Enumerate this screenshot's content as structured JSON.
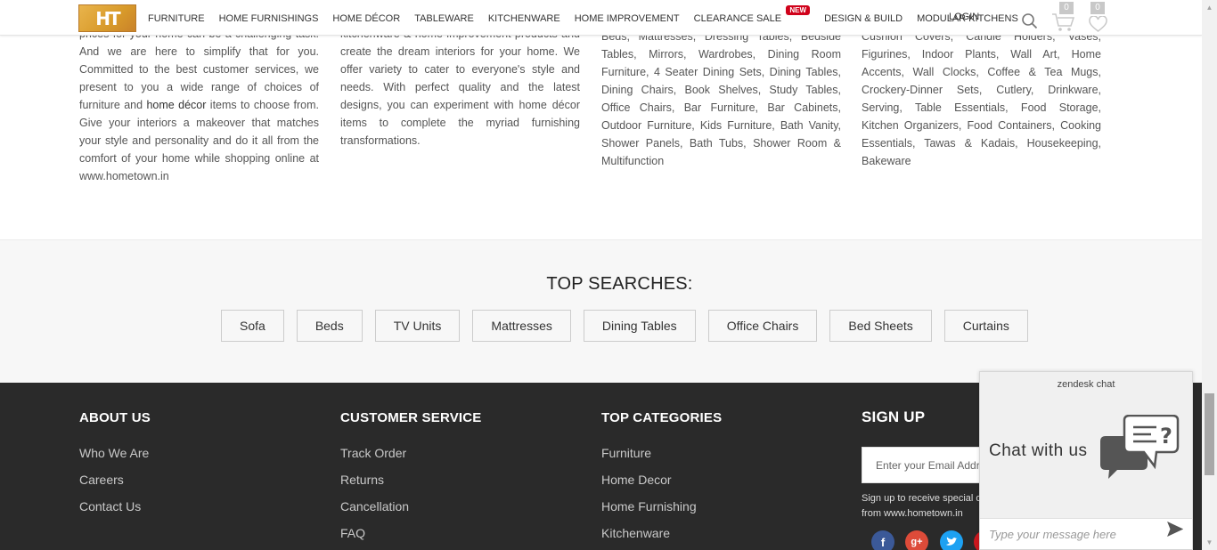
{
  "header": {
    "logo_text": "HT",
    "nav": [
      "FURNITURE",
      "HOME FURNISHINGS",
      "HOME DÉCOR",
      "TABLEWARE",
      "KITCHENWARE",
      "HOME IMPROVEMENT",
      "CLEARANCE SALE",
      "DESIGN & BUILD",
      "MODULAR KITCHENS"
    ],
    "new_badge": "NEW",
    "login": "LOGIN",
    "cart_count": "0",
    "wishlist_count": "0"
  },
  "seo": {
    "col1_pre": "prices for your home can be a challenging task. And we are here to simplify that for you. Committed to the best customer services, we present to you a wide range of choices of furniture and",
    "col1_link": "home décor",
    "col1_post": "items to choose from. Give your interiors a makeover that matches your style and personality and do it all from the comfort of your home while shopping online at www.hometown.in",
    "col2": "kitchenware & home improvement products and create the dream interiors for your home. We offer variety to cater to everyone's style and needs. With perfect quality and the latest designs, you can experiment with home décor items to complete the myriad furnishing transformations.",
    "col3": "Beds, Mattresses, Dressing Tables, Bedside Tables, Mirrors, Wardrobes, Dining Room Furniture, 4 Seater Dining Sets, Dining Tables, Dining Chairs, Book Shelves, Study Tables, Office Chairs, Bar Furniture, Bar Cabinets, Outdoor Furniture, Kids Furniture, Bath Vanity, Shower Panels, Bath Tubs, Shower Room & Multifunction",
    "col4": "Cushion Covers, Candle Holders, Vases, Figurines, Indoor Plants, Wall Art, Home Accents, Wall Clocks, Coffee & Tea Mugs, Crockery-Dinner Sets, Cutlery, Drinkware, Serving, Table Essentials, Food Storage, Kitchen Organizers, Food Containers, Cooking Essentials, Tawas & Kadais, Housekeeping, Bakeware"
  },
  "top_searches": {
    "title": "TOP SEARCHES:",
    "items": [
      "Sofa",
      "Beds",
      "TV Units",
      "Mattresses",
      "Dining Tables",
      "Office Chairs",
      "Bed Sheets",
      "Curtains"
    ]
  },
  "footer": {
    "about": {
      "title": "ABOUT US",
      "links": [
        "Who We Are",
        "Careers",
        "Contact Us"
      ]
    },
    "service": {
      "title": "CUSTOMER SERVICE",
      "links": [
        "Track Order",
        "Returns",
        "Cancellation",
        "FAQ"
      ]
    },
    "categories": {
      "title": "TOP CATEGORIES",
      "links": [
        "Furniture",
        "Home Decor",
        "Home Furnishing",
        "Kitchenware"
      ]
    },
    "signup": {
      "title": "SIGN UP",
      "placeholder": "Enter your Email Address",
      "note_line1": "Sign up to receive special offers and updates",
      "note_line2": "from www.hometown.in"
    },
    "social": [
      "facebook-icon",
      "google-plus-icon",
      "twitter-icon",
      "youtube-icon"
    ]
  },
  "zendesk": {
    "title": "zendesk chat",
    "chat_label": "Chat with us",
    "input_placeholder": "Type your message here"
  },
  "colors": {
    "footer_bg": "#2a2a2a",
    "badge_red": "#d0021b",
    "facebook": "#3b5998",
    "google": "#dd4b39",
    "twitter": "#1da1f2"
  }
}
